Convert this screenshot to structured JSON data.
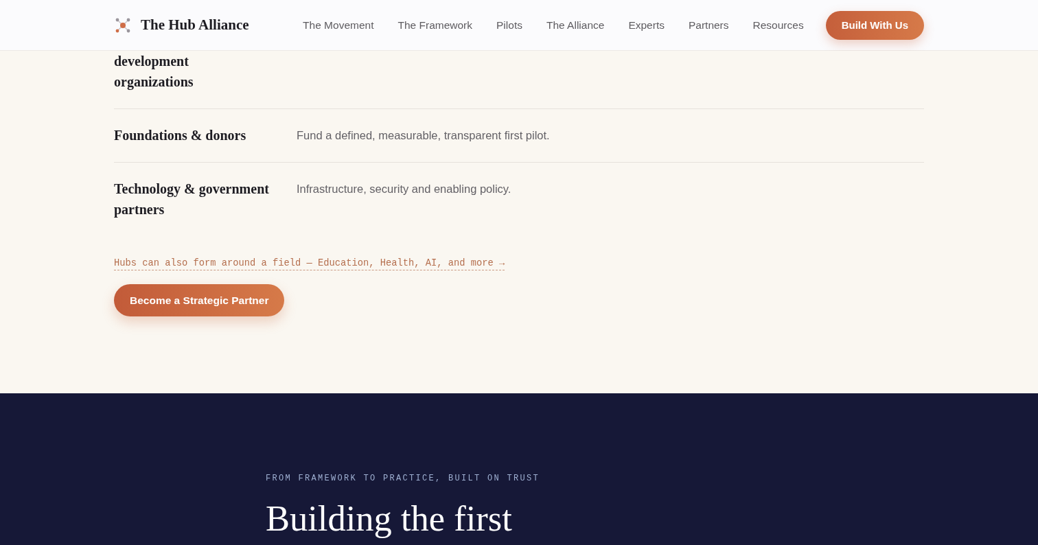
{
  "header": {
    "brand": "The Hub Alliance",
    "nav": [
      {
        "label": "The Movement"
      },
      {
        "label": "The Framework"
      },
      {
        "label": "Pilots"
      },
      {
        "label": "The Alliance"
      },
      {
        "label": "Experts"
      },
      {
        "label": "Partners"
      },
      {
        "label": "Resources"
      }
    ],
    "cta": "Build With Us"
  },
  "partner_rows": [
    {
      "label": "development\norganizations"
    },
    {
      "label": "Foundations & donors",
      "description": "Fund a defined, measurable, transparent first pilot."
    },
    {
      "label": "Technology & government partners",
      "description": "Infrastructure, security and enabling policy."
    }
  ],
  "field_link": "Hubs can also form around a field — Education, Health, AI, and more →",
  "partner_button": "Become a Strategic Partner",
  "next_section": {
    "eyebrow": "FROM FRAMEWORK TO PRACTICE, BUILT ON TRUST",
    "heading": "Building the first"
  }
}
